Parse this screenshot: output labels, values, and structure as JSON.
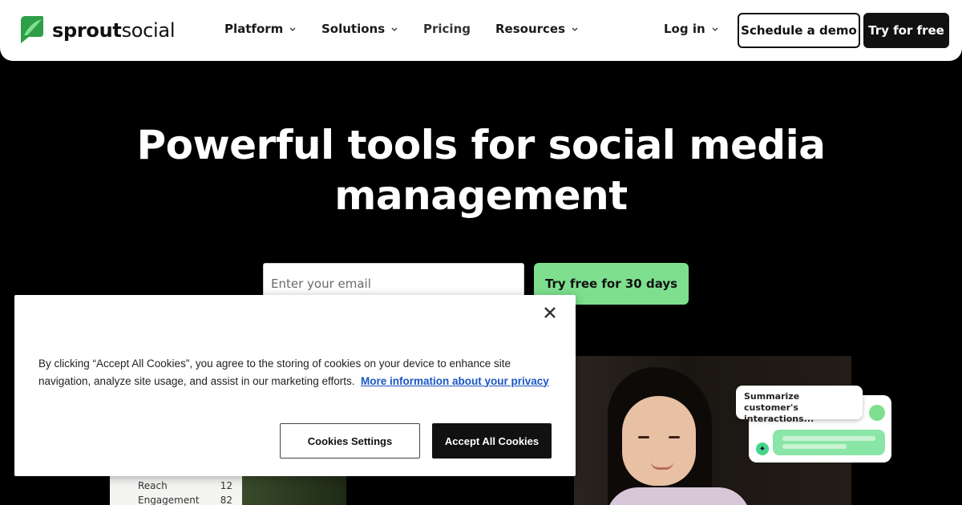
{
  "header": {
    "logo": {
      "brand_bold": "sprout",
      "brand_light": "social",
      "icon": "sprout-leaf-logo"
    },
    "nav": [
      {
        "label": "Platform",
        "has_dropdown": true
      },
      {
        "label": "Solutions",
        "has_dropdown": true
      },
      {
        "label": "Pricing",
        "has_dropdown": false
      },
      {
        "label": "Resources",
        "has_dropdown": true
      }
    ],
    "login_label": "Log in",
    "demo_label": "Schedule a demo",
    "try_label": "Try for free"
  },
  "hero": {
    "title": "Powerful tools for social media management",
    "email_placeholder": "Enter your email",
    "email_value": "",
    "cta_label": "Try free for 30 days",
    "stats": [
      {
        "label": "Reach",
        "value": "12"
      },
      {
        "label": "Engagement",
        "value": "82"
      }
    ],
    "ai_prompt": "Summarize customer's interactions..."
  },
  "cookie_banner": {
    "text": "By clicking “Accept All Cookies”, you agree to the storing of cookies on your device to enhance site navigation, analyze site usage, and assist in our marketing efforts.",
    "link_label": "More information about your privacy",
    "settings_label": "Cookies Settings",
    "accept_label": "Accept All Cookies",
    "close_icon": "close-icon"
  },
  "colors": {
    "accent_green": "#7ee08e",
    "hero_bg": "#000000",
    "link_blue": "#1a56c4"
  }
}
